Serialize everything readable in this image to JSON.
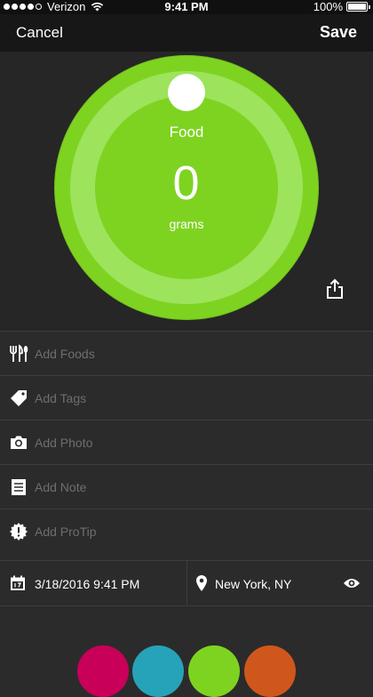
{
  "status_bar": {
    "carrier": "Verizon",
    "time": "9:41 PM",
    "battery": "100%"
  },
  "nav": {
    "cancel_label": "Cancel",
    "save_label": "Save"
  },
  "dial": {
    "label": "Food",
    "value": "0",
    "unit": "grams",
    "color": "#7ed321"
  },
  "rows": [
    {
      "icon": "utensils-icon",
      "label": "Add Foods"
    },
    {
      "icon": "tag-icon",
      "label": "Add Tags"
    },
    {
      "icon": "camera-icon",
      "label": "Add Photo"
    },
    {
      "icon": "note-icon",
      "label": "Add Note"
    },
    {
      "icon": "protip-icon",
      "label": "Add ProTip"
    }
  ],
  "meta": {
    "datetime": "3/18/2016 9:41 PM",
    "location": "New York, NY"
  },
  "color_options": [
    "#c8005a",
    "#26a3b8",
    "#7ed321",
    "#d0571b"
  ]
}
